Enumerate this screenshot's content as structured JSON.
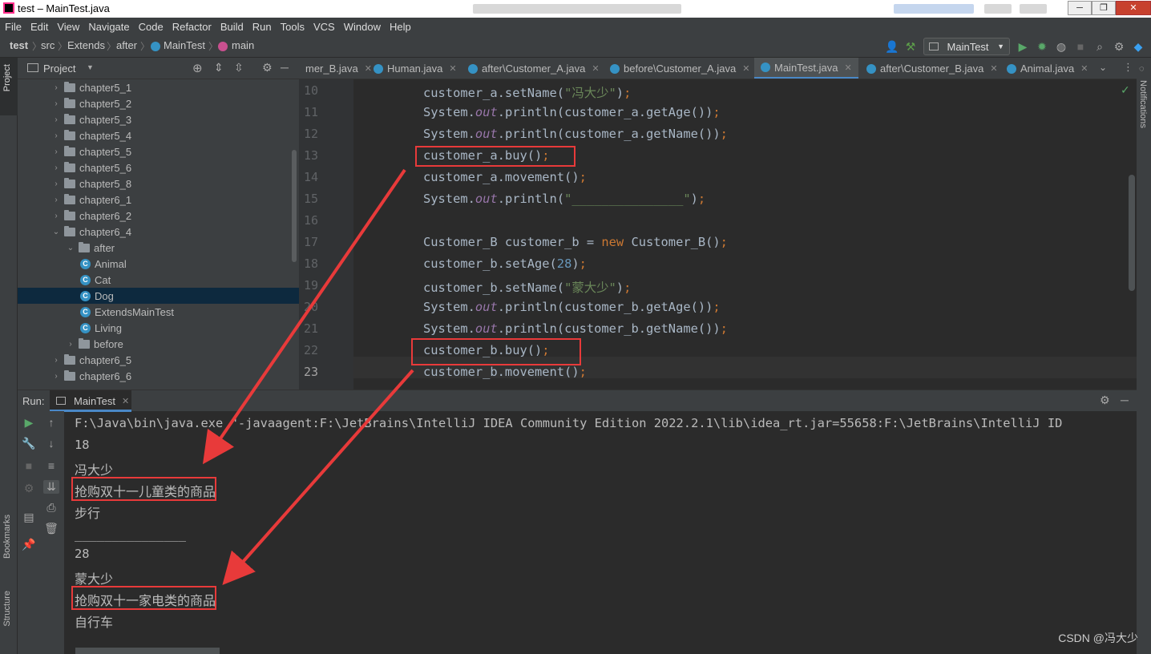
{
  "window": {
    "title": "test – MainTest.java",
    "app_icon": "intellij-icon"
  },
  "menu": [
    "File",
    "Edit",
    "View",
    "Navigate",
    "Code",
    "Refactor",
    "Build",
    "Run",
    "Tools",
    "VCS",
    "Window",
    "Help"
  ],
  "breadcrumb": [
    "test",
    "src",
    "Extends",
    "after",
    "MainTest",
    "main"
  ],
  "toolbar": {
    "run_config": "MainTest"
  },
  "project": {
    "header": "Project",
    "tree": [
      {
        "label": "chapter5_1",
        "kind": "folder",
        "depth": 1,
        "exp": "closed"
      },
      {
        "label": "chapter5_2",
        "kind": "folder",
        "depth": 1,
        "exp": "closed"
      },
      {
        "label": "chapter5_3",
        "kind": "folder",
        "depth": 1,
        "exp": "closed"
      },
      {
        "label": "chapter5_4",
        "kind": "folder",
        "depth": 1,
        "exp": "closed"
      },
      {
        "label": "chapter5_5",
        "kind": "folder",
        "depth": 1,
        "exp": "closed"
      },
      {
        "label": "chapter5_6",
        "kind": "folder",
        "depth": 1,
        "exp": "closed"
      },
      {
        "label": "chapter5_8",
        "kind": "folder",
        "depth": 1,
        "exp": "closed"
      },
      {
        "label": "chapter6_1",
        "kind": "folder",
        "depth": 1,
        "exp": "closed"
      },
      {
        "label": "chapter6_2",
        "kind": "folder",
        "depth": 1,
        "exp": "closed"
      },
      {
        "label": "chapter6_4",
        "kind": "folder",
        "depth": 1,
        "exp": "open"
      },
      {
        "label": "after",
        "kind": "folder",
        "depth": 2,
        "exp": "open"
      },
      {
        "label": "Animal",
        "kind": "class",
        "depth": 3
      },
      {
        "label": "Cat",
        "kind": "class",
        "depth": 3
      },
      {
        "label": "Dog",
        "kind": "class",
        "depth": 3,
        "selected": true
      },
      {
        "label": "ExtendsMainTest",
        "kind": "class",
        "depth": 3
      },
      {
        "label": "Living",
        "kind": "class",
        "depth": 3
      },
      {
        "label": "before",
        "kind": "folder",
        "depth": 2,
        "exp": "closed"
      },
      {
        "label": "chapter6_5",
        "kind": "folder",
        "depth": 1,
        "exp": "closed"
      },
      {
        "label": "chapter6_6",
        "kind": "folder",
        "depth": 1,
        "exp": "closed"
      }
    ]
  },
  "tabs": [
    {
      "label": "mer_B.java",
      "active": false
    },
    {
      "label": "Human.java",
      "active": false
    },
    {
      "label": "after\\Customer_A.java",
      "active": false
    },
    {
      "label": "before\\Customer_A.java",
      "active": false
    },
    {
      "label": "MainTest.java",
      "active": true
    },
    {
      "label": "after\\Customer_B.java",
      "active": false
    },
    {
      "label": "Animal.java",
      "active": false
    }
  ],
  "code": [
    {
      "n": "10",
      "t": "customer_a.setName(\"冯大少\");"
    },
    {
      "n": "11",
      "t": "System.out.println(customer_a.getAge());"
    },
    {
      "n": "12",
      "t": "System.out.println(customer_a.getName());"
    },
    {
      "n": "13",
      "t": "customer_a.buy();"
    },
    {
      "n": "14",
      "t": "customer_a.movement();"
    },
    {
      "n": "15",
      "t": "System.out.println(\"_______________\");"
    },
    {
      "n": "16",
      "t": ""
    },
    {
      "n": "17",
      "t": "Customer_B customer_b = new Customer_B();"
    },
    {
      "n": "18",
      "t": "customer_b.setAge(28);"
    },
    {
      "n": "19",
      "t": "customer_b.setName(\"蒙大少\");"
    },
    {
      "n": "20",
      "t": "System.out.println(customer_b.getAge());"
    },
    {
      "n": "21",
      "t": "System.out.println(customer_b.getName());"
    },
    {
      "n": "22",
      "t": "customer_b.buy();"
    },
    {
      "n": "23",
      "t": "customer_b.movement();"
    }
  ],
  "run": {
    "label": "Run:",
    "tab": "MainTest",
    "output": [
      "F:\\Java\\bin\\java.exe \"-javaagent:F:\\JetBrains\\IntelliJ IDEA Community Edition 2022.2.1\\lib\\idea_rt.jar=55658:F:\\JetBrains\\IntelliJ ID",
      "18",
      "冯大少",
      "抢购双十一儿童类的商品",
      "步行",
      "_______________",
      "28",
      "蒙大少",
      "抢购双十一家电类的商品",
      "自行车"
    ]
  },
  "side_tabs": {
    "left_top": "Project",
    "left_mid": "Bookmarks",
    "left_bottom": "Structure",
    "right": "Notifications"
  },
  "watermark": "CSDN @冯大少",
  "colors": {
    "accent": "#4a88c7",
    "annotation": "#e83a3a",
    "bg": "#2b2b2b"
  }
}
